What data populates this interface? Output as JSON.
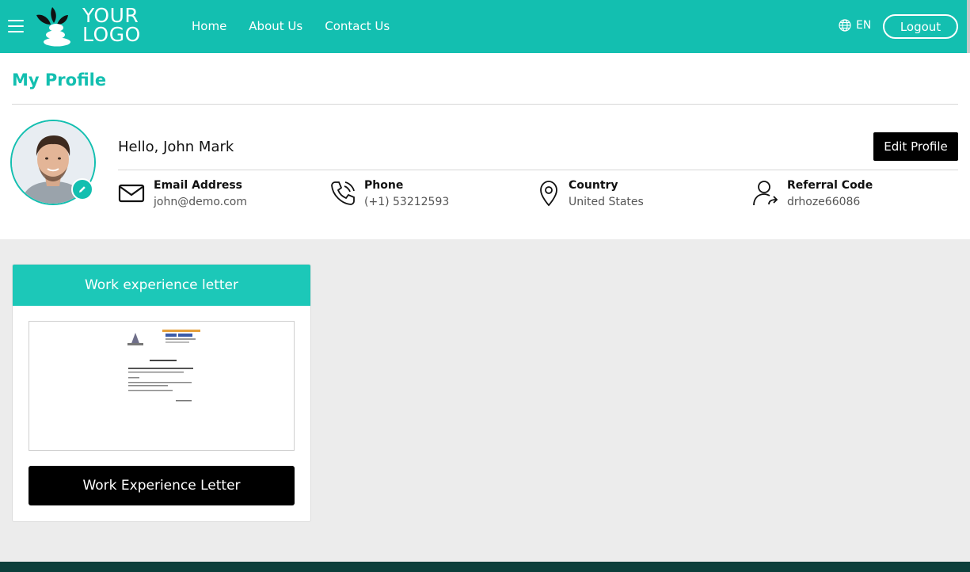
{
  "header": {
    "logo_line1": "YOUR",
    "logo_line2": "LOGO",
    "nav": [
      "Home",
      "About Us",
      "Contact Us"
    ],
    "language": "EN",
    "logout_label": "Logout"
  },
  "profile": {
    "page_title": "My Profile",
    "greeting": "Hello, John Mark",
    "edit_label": "Edit Profile",
    "fields": [
      {
        "label": "Email Address",
        "value": "john@demo.com",
        "icon": "envelope-icon"
      },
      {
        "label": "Phone",
        "value": "(+1) 53212593",
        "icon": "phone-icon"
      },
      {
        "label": "Country",
        "value": "United States",
        "icon": "map-pin-icon"
      },
      {
        "label": "Referral Code",
        "value": "drhoze66086",
        "icon": "user-share-icon"
      }
    ]
  },
  "card": {
    "title": "Work experience letter",
    "button_label": "Work Experience Letter"
  },
  "colors": {
    "accent": "#13bfb0",
    "card_header": "#1cc8b8",
    "footer": "#0b3e3a"
  }
}
